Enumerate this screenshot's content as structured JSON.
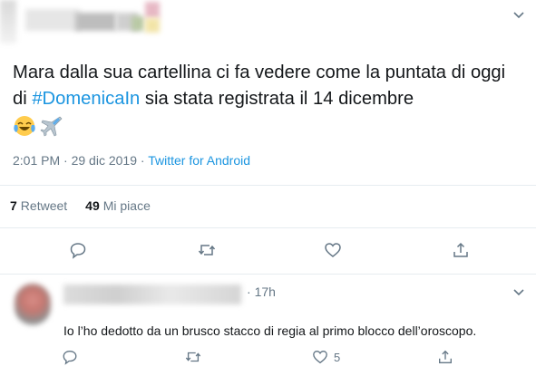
{
  "tweet": {
    "text_before_hashtag": "Mara dalla sua cartellina ci fa vedere come la puntata di oggi di ",
    "hashtag": "#DomenicaIn",
    "text_after_hashtag": " sia stata registrata il 14 dicembre",
    "emojis": [
      "face-with-tears-of-joy",
      "airplane"
    ],
    "time": "2:01 PM",
    "date": "29 dic 2019",
    "separator": "·",
    "source": "Twitter for Android"
  },
  "stats": {
    "retweets_count": "7",
    "retweets_label": "Retweet",
    "likes_count": "49",
    "likes_label": "Mi piace"
  },
  "reply": {
    "time": "17h",
    "separator": "·",
    "text": "Io l’ho dedotto da un brusco stacco di regia al primo blocco dell’oroscopo.",
    "like_count": "5"
  },
  "icons": {
    "chevron": "chevron-down-icon",
    "reply": "reply-icon",
    "retweet": "retweet-icon",
    "like": "heart-icon",
    "share": "share-icon"
  },
  "colors": {
    "accent": "#1b95e0",
    "text": "#14171a",
    "secondary": "#657786",
    "divider": "#e6ecf0"
  }
}
